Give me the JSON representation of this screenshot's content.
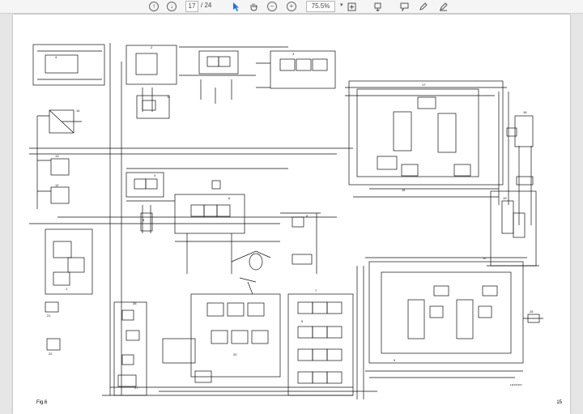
{
  "toolbar": {
    "page_current": "17",
    "page_total": "/ 24",
    "zoom": "75.5%",
    "icons": [
      "arrow-up-icon",
      "arrow-down-icon",
      "cursor-icon",
      "hand-icon",
      "zoom-out-icon",
      "zoom-in-icon",
      "fit-page-icon",
      "page-layout-icon",
      "comment-icon",
      "pen-icon",
      "sign-icon"
    ]
  },
  "document": {
    "figure_label": "Fig.6",
    "page_number": "15",
    "drawing_id": "111001504",
    "block_labels": [
      "14",
      "4",
      "11",
      "2",
      "3",
      "17",
      "16",
      "18",
      "19",
      "13",
      "12",
      "1",
      "21",
      "22",
      "6",
      "4",
      "8",
      "8",
      "20",
      "26",
      "27",
      "7",
      "5",
      "10",
      "9",
      "25"
    ]
  }
}
